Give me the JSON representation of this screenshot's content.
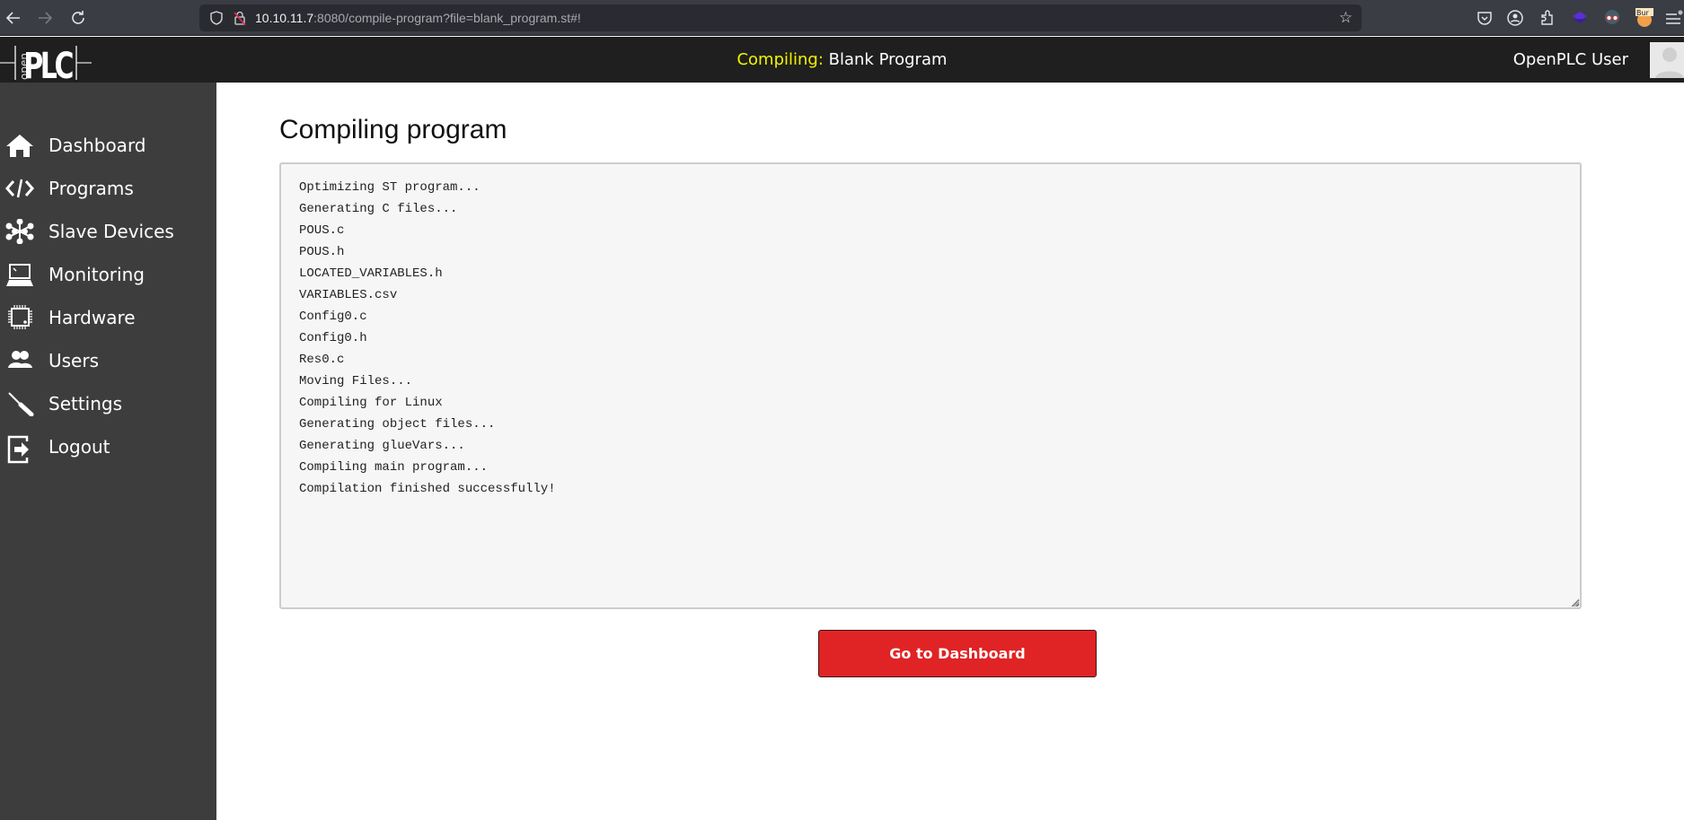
{
  "browser": {
    "url_host": "10.10.11.7",
    "url_rest": ":8080/compile-program?file=blank_program.st#!",
    "back_icon": "arrow-left",
    "forward_icon": "arrow-right",
    "reload_icon": "reload",
    "extension_badge": "Bur"
  },
  "header": {
    "status_label": "Compiling:",
    "program_name": "Blank Program",
    "user_name": "OpenPLC User",
    "logo_text_small": "open",
    "logo_text_big": "PLC"
  },
  "sidebar": {
    "items": [
      {
        "label": "Dashboard",
        "icon": "home"
      },
      {
        "label": "Programs",
        "icon": "code"
      },
      {
        "label": "Slave Devices",
        "icon": "network"
      },
      {
        "label": "Monitoring",
        "icon": "laptop"
      },
      {
        "label": "Hardware",
        "icon": "chip"
      },
      {
        "label": "Users",
        "icon": "users"
      },
      {
        "label": "Settings",
        "icon": "screwdriver"
      },
      {
        "label": "Logout",
        "icon": "logout"
      }
    ]
  },
  "main": {
    "title": "Compiling program",
    "output_lines": [
      "Optimizing ST program...",
      "Generating C files...",
      "POUS.c",
      "POUS.h",
      "LOCATED_VARIABLES.h",
      "VARIABLES.csv",
      "Config0.c",
      "Config0.h",
      "Res0.c",
      "Moving Files...",
      "Compiling for Linux",
      "Generating object files...",
      "Generating glueVars...",
      "Compiling main program...",
      "Compilation finished successfully!"
    ],
    "button_label": "Go to Dashboard"
  },
  "colors": {
    "accent_button": "#e02325",
    "header_status": "#f4f400",
    "sidebar_bg": "#3d3d3d",
    "header_bg": "#1f1f1f"
  }
}
